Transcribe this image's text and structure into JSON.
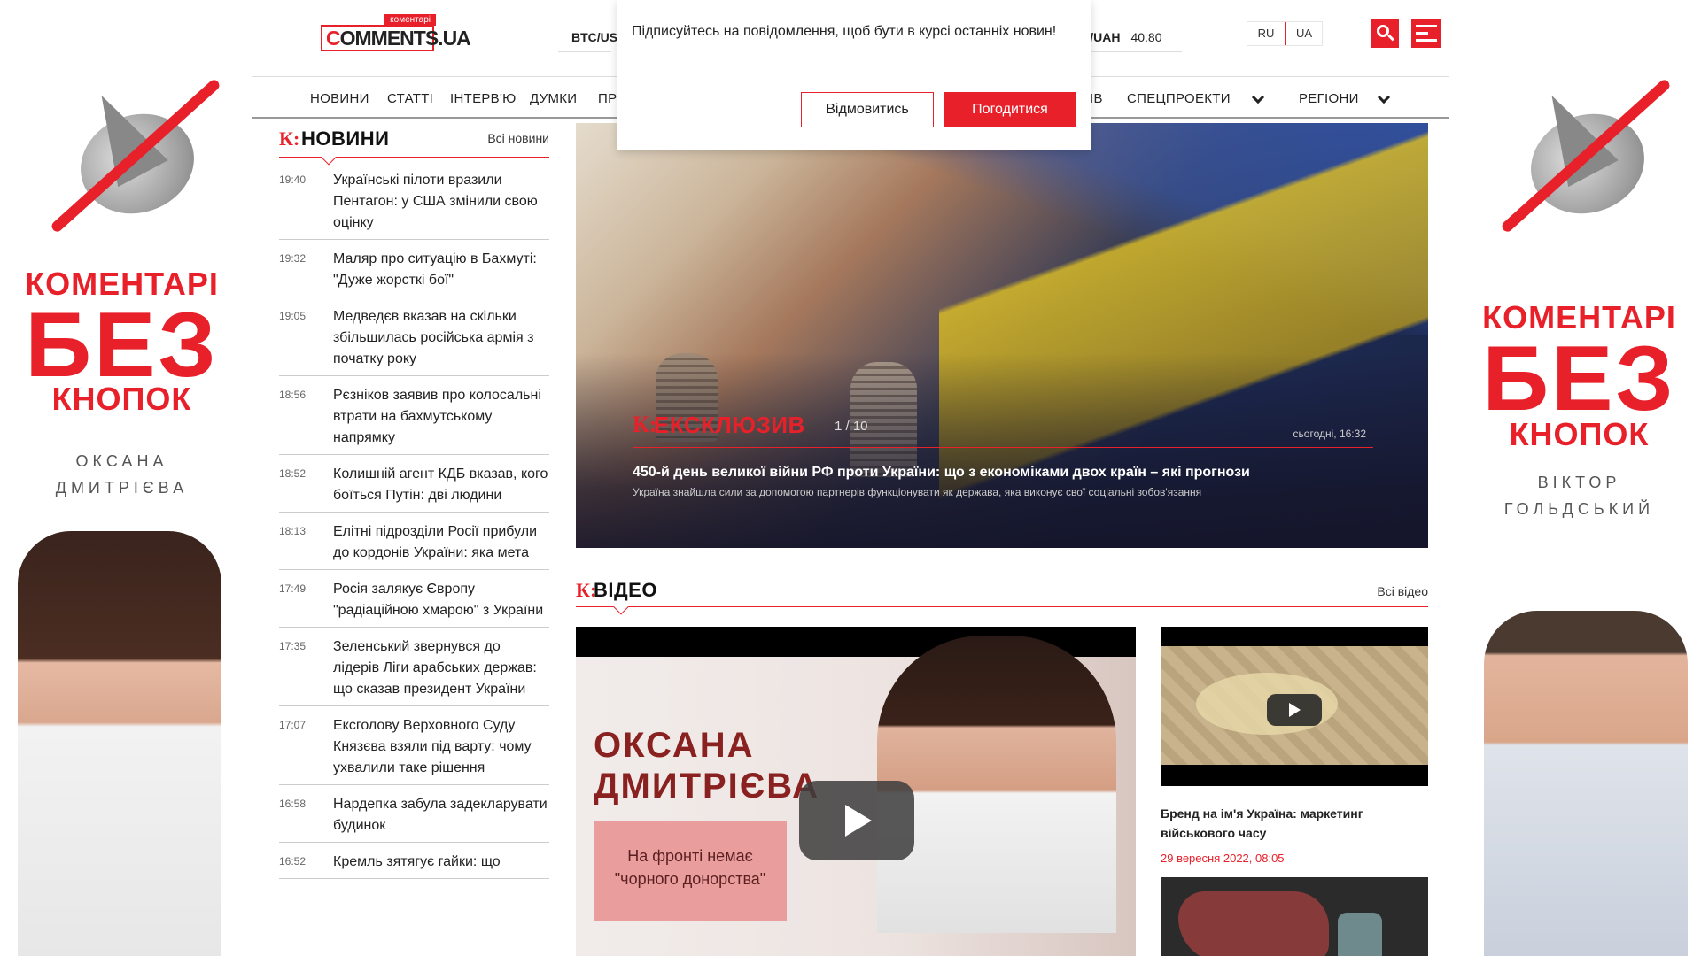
{
  "colors": {
    "accent": "#e8202a",
    "text": "#222222"
  },
  "banner_left": {
    "line1": "КОМЕНТАРІ",
    "line2": "БЕЗ",
    "line3": "КНОПОК",
    "name1": "ОКСАНА",
    "name2": "ДМИТРІЄВА"
  },
  "banner_right": {
    "line1": "КОМЕНТАРІ",
    "line2": "БЕЗ",
    "line3": "КНОПОК",
    "name1": "ВІКТОР",
    "name2": "ГОЛЬДСЬКИЙ"
  },
  "logo": {
    "top": "коментарі",
    "main": "OMMENTS.UA",
    "first": "C"
  },
  "currency": [
    {
      "pair": "BTC/US",
      "value": ""
    },
    {
      "pair": "UR/UAH",
      "value": "40.80"
    }
  ],
  "languages": [
    "RU",
    "UA"
  ],
  "nav": {
    "items": [
      "НОВИНИ",
      "СТАТТІ",
      "ІНТЕРВ'Ю",
      "ДУМКИ",
      "ПР",
      "ІВ",
      "СПЕЦПРОЕКТИ",
      "РЕГІОНИ"
    ]
  },
  "dialog": {
    "message": "Підписуйтесь на повідомлення, щоб бути в курсі останніх новин!",
    "deny": "Відмовитись",
    "accept": "Погодитися"
  },
  "news": {
    "k": "К:",
    "title": "НОВИНИ",
    "all": "Всі новини",
    "items": [
      {
        "time": "19:40",
        "text": "Українські пілоти вразили Пентагон: у США змінили свою оцінку"
      },
      {
        "time": "19:32",
        "text": "Маляр про ситуацію в Бахмуті: \"Дуже жорсткі бої\""
      },
      {
        "time": "19:05",
        "text": "Медведєв вказав на скільки збільшилась російська армія з початку року"
      },
      {
        "time": "18:56",
        "text": "Рєзніков заявив про колосальні втрати на бахмутському напрямку"
      },
      {
        "time": "18:52",
        "text": "Колишній агент КДБ вказав, кого боїться Путін: дві людини"
      },
      {
        "time": "18:13",
        "text": "Елітні підрозділи Росії прибули до кордонів України: яка мета"
      },
      {
        "time": "17:49",
        "text": "Росія залякує Європу \"радіаційною хмарою\" з України"
      },
      {
        "time": "17:35",
        "text": "Зеленський звернувся до лідерів Ліги арабських держав: що сказав президент України"
      },
      {
        "time": "17:07",
        "text": "Ексголову Верховного Суду Князєва взяли під варту: чому ухвалили таке рішення"
      },
      {
        "time": "16:58",
        "text": "Нардепка забула задекларувати будинок"
      },
      {
        "time": "16:52",
        "text": "Кремль зятягує гайки: що"
      }
    ]
  },
  "hero": {
    "k": "К:",
    "label": "ЕКСКЛЮЗИВ",
    "counter": "1 / 10",
    "date": "сьогодні, 16:32",
    "headline": "450-й день великої війни РФ проти України: що з економіками двох країн – які прогнози",
    "subtitle": "Україна знайшла сили за допомогою партнерів функціонувати як держава, яка виконує свої соціальні зобов'язання"
  },
  "video": {
    "k": "К:",
    "title": "ВІДЕО",
    "all": "Всі відео",
    "main": {
      "line1": "ОКСАНА",
      "line2": "ДМИТРІЄВА",
      "quote": "На фронті немає \"чорного донорства\""
    },
    "side": {
      "title": "Бренд на ім'я Україна: маркетинг військового часу",
      "date": "29 вересня 2022, 08:05"
    }
  }
}
